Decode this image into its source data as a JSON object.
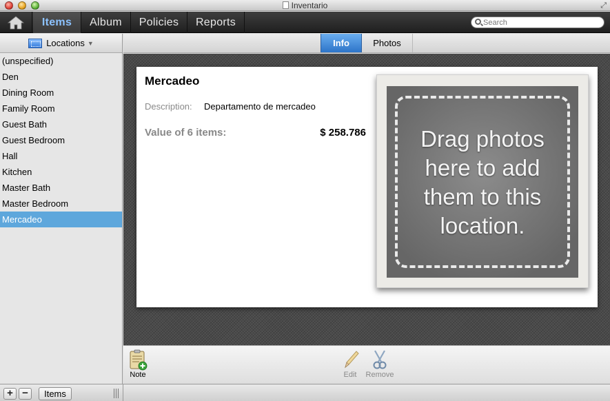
{
  "window": {
    "title": "Inventario"
  },
  "toolbar": {
    "tabs": [
      {
        "label": "Items"
      },
      {
        "label": "Album"
      },
      {
        "label": "Policies"
      },
      {
        "label": "Reports"
      }
    ],
    "active_tab": "Items",
    "search": {
      "placeholder": "Search",
      "value": ""
    }
  },
  "sidebar": {
    "header": "Locations",
    "items": [
      {
        "label": "(unspecified)"
      },
      {
        "label": "Den"
      },
      {
        "label": "Dining Room"
      },
      {
        "label": "Family Room"
      },
      {
        "label": "Guest Bath"
      },
      {
        "label": "Guest Bedroom"
      },
      {
        "label": "Hall"
      },
      {
        "label": "Kitchen"
      },
      {
        "label": "Master Bath"
      },
      {
        "label": "Master Bedroom"
      },
      {
        "label": "Mercadeo"
      }
    ],
    "selected": "Mercadeo"
  },
  "detail_tabs": [
    {
      "label": "Info"
    },
    {
      "label": "Photos"
    }
  ],
  "detail": {
    "title": "Mercadeo",
    "description_label": "Description:",
    "description_value": "Departamento de mercadeo",
    "value_label": "Value of 6 items:",
    "value_amount": "$ 258.786",
    "photo_drop_text": "Drag photos here to add them to this location."
  },
  "actions": {
    "note": "Note",
    "edit": "Edit",
    "remove": "Remove"
  },
  "footer": {
    "add": "+",
    "remove": "−",
    "items_button": "Items"
  },
  "colors": {
    "accent_selected": "#5ea7dc",
    "active_tab_text": "#8cc2ff",
    "info_tab": "#3d86d8"
  },
  "icons": [
    "home-icon",
    "search-icon",
    "locations-icon",
    "note-icon",
    "pencil-icon",
    "scissors-icon",
    "resize-grip-icon"
  ]
}
